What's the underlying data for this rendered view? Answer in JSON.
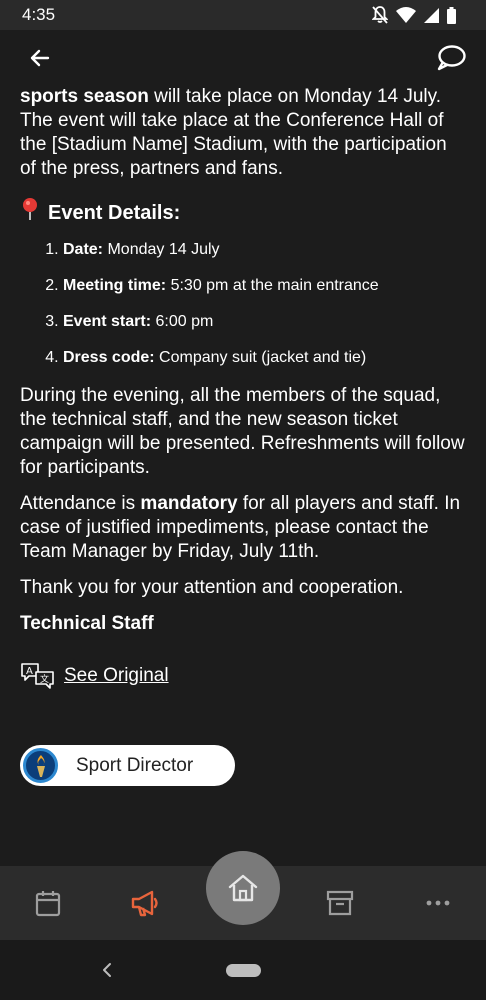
{
  "status_bar": {
    "time": "4:35"
  },
  "post": {
    "intro_bold": "sports season",
    "intro_rest": " will take place on Monday 14 July. The event will take place at the Conference Hall of the [Stadium Name] Stadium, with the participation of the press, partners and fans.",
    "details_title": "Event Details:",
    "details": [
      {
        "label": "Date:",
        "value": " Monday 14 July"
      },
      {
        "label": "Meeting time:",
        "value": " 5:30 pm at the main entrance"
      },
      {
        "label": "Event start:",
        "value": " 6:00 pm"
      },
      {
        "label": "Dress code:",
        "value": " Company suit (jacket and tie)"
      }
    ],
    "paragraph_1": "During the evening, all the members of the squad, the technical staff, and the new season ticket campaign will be presented. Refreshments will follow for participants.",
    "paragraph_2_start": "Attendance is ",
    "paragraph_2_bold": "mandatory",
    "paragraph_2_end": " for all players and staff. In case of justified impediments, please contact the Team Manager by Friday, July 11th.",
    "paragraph_3": "Thank you for your attention and cooperation.",
    "signature": "Technical Staff",
    "see_original": "See Original"
  },
  "author": {
    "name": "Sport Director"
  },
  "bottom_nav": {
    "items": [
      "calendar-icon",
      "megaphone-icon",
      "home-icon",
      "archive-icon",
      "more-icon"
    ],
    "active": "megaphone-icon",
    "accent_color": "#e8643c"
  }
}
